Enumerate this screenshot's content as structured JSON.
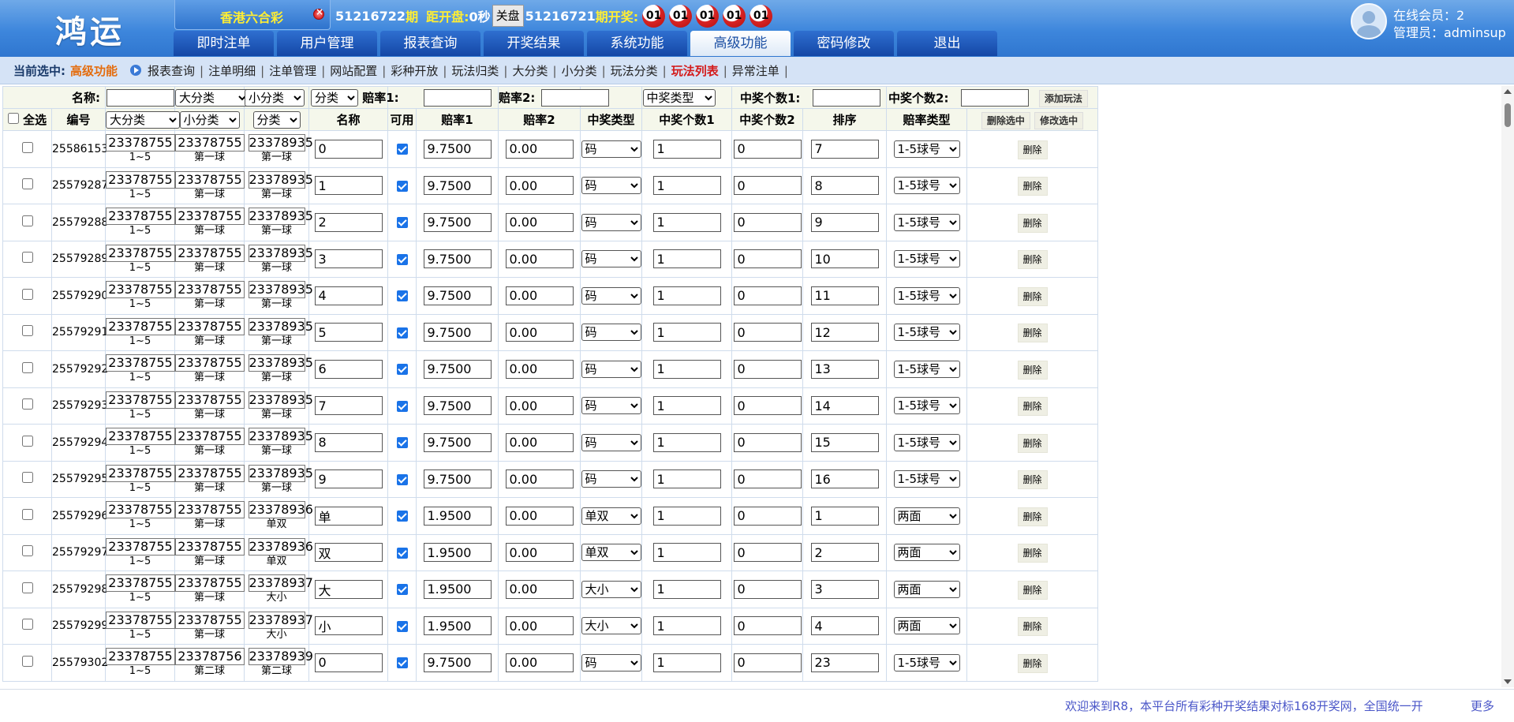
{
  "logo": "鸿运",
  "lottery": {
    "name": "香港六合彩"
  },
  "info": {
    "current_issue": "51216722",
    "issue_unit": "期",
    "countdown_label": "距开盘:",
    "countdown_value": "0秒",
    "stop_button": "关盘",
    "prev_issue": "51216721",
    "prev_label": "期开奖:",
    "balls": [
      "01",
      "01",
      "01",
      "01",
      "01"
    ]
  },
  "nav": [
    "即时注单",
    "用户管理",
    "报表查询",
    "开奖结果",
    "系统功能",
    "高级功能",
    "密码修改",
    "退出"
  ],
  "nav_active": "高级功能",
  "user": {
    "online": "在线会员：2",
    "admin": "管理员：adminsup"
  },
  "crumb": {
    "label": "当前选中:",
    "current": "高级功能",
    "links": [
      "报表查询",
      "注单明细",
      "注单管理",
      "网站配置",
      "彩种开放",
      "玩法归类",
      "大分类",
      "小分类",
      "玩法分类",
      "玩法列表",
      "异常注单"
    ],
    "active_link": "玩法列表"
  },
  "filter": {
    "name_label": "名称:",
    "big_cat": "大分类",
    "small_cat": "小分类",
    "cat": "分类",
    "odds1_label": "赔率1:",
    "odds2_label": "赔率2:",
    "win_type": "中奖类型",
    "win_count1_label": "中奖个数1:",
    "win_count2_label": "中奖个数2:",
    "add_button": "添加玩法"
  },
  "headers": {
    "select_all": "全选",
    "id": "编号",
    "big_cat": "大分类",
    "small_cat": "小分类",
    "cat": "分类",
    "name": "名称",
    "enabled": "可用",
    "odds1": "赔率1",
    "odds2": "赔率2",
    "win_type": "中奖类型",
    "win_count1": "中奖个数1",
    "win_count2": "中奖个数2",
    "order": "排序",
    "odds_type": "赔率类型",
    "delete_selected": "删除选中",
    "modify_selected": "修改选中"
  },
  "delete_label": "删除",
  "rows": [
    {
      "id": "25586153",
      "big": "23378755",
      "big_sub": "1~5",
      "small": "23378755",
      "small_sub": "第一球",
      "cat": "23378935",
      "cat_sub": "第一球",
      "name": "0",
      "odds1": "9.7500",
      "odds2": "0.00",
      "win_type": "码",
      "c1": "1",
      "c2": "0",
      "order": "7",
      "odds_type": "1-5球号"
    },
    {
      "id": "25579287",
      "big": "23378755",
      "big_sub": "1~5",
      "small": "23378755",
      "small_sub": "第一球",
      "cat": "23378935",
      "cat_sub": "第一球",
      "name": "1",
      "odds1": "9.7500",
      "odds2": "0.00",
      "win_type": "码",
      "c1": "1",
      "c2": "0",
      "order": "8",
      "odds_type": "1-5球号"
    },
    {
      "id": "25579288",
      "big": "23378755",
      "big_sub": "1~5",
      "small": "23378755",
      "small_sub": "第一球",
      "cat": "23378935",
      "cat_sub": "第一球",
      "name": "2",
      "odds1": "9.7500",
      "odds2": "0.00",
      "win_type": "码",
      "c1": "1",
      "c2": "0",
      "order": "9",
      "odds_type": "1-5球号"
    },
    {
      "id": "25579289",
      "big": "23378755",
      "big_sub": "1~5",
      "small": "23378755",
      "small_sub": "第一球",
      "cat": "23378935",
      "cat_sub": "第一球",
      "name": "3",
      "odds1": "9.7500",
      "odds2": "0.00",
      "win_type": "码",
      "c1": "1",
      "c2": "0",
      "order": "10",
      "odds_type": "1-5球号"
    },
    {
      "id": "25579290",
      "big": "23378755",
      "big_sub": "1~5",
      "small": "23378755",
      "small_sub": "第一球",
      "cat": "23378935",
      "cat_sub": "第一球",
      "name": "4",
      "odds1": "9.7500",
      "odds2": "0.00",
      "win_type": "码",
      "c1": "1",
      "c2": "0",
      "order": "11",
      "odds_type": "1-5球号"
    },
    {
      "id": "25579291",
      "big": "23378755",
      "big_sub": "1~5",
      "small": "23378755",
      "small_sub": "第一球",
      "cat": "23378935",
      "cat_sub": "第一球",
      "name": "5",
      "odds1": "9.7500",
      "odds2": "0.00",
      "win_type": "码",
      "c1": "1",
      "c2": "0",
      "order": "12",
      "odds_type": "1-5球号"
    },
    {
      "id": "25579292",
      "big": "23378755",
      "big_sub": "1~5",
      "small": "23378755",
      "small_sub": "第一球",
      "cat": "23378935",
      "cat_sub": "第一球",
      "name": "6",
      "odds1": "9.7500",
      "odds2": "0.00",
      "win_type": "码",
      "c1": "1",
      "c2": "0",
      "order": "13",
      "odds_type": "1-5球号"
    },
    {
      "id": "25579293",
      "big": "23378755",
      "big_sub": "1~5",
      "small": "23378755",
      "small_sub": "第一球",
      "cat": "23378935",
      "cat_sub": "第一球",
      "name": "7",
      "odds1": "9.7500",
      "odds2": "0.00",
      "win_type": "码",
      "c1": "1",
      "c2": "0",
      "order": "14",
      "odds_type": "1-5球号"
    },
    {
      "id": "25579294",
      "big": "23378755",
      "big_sub": "1~5",
      "small": "23378755",
      "small_sub": "第一球",
      "cat": "23378935",
      "cat_sub": "第一球",
      "name": "8",
      "odds1": "9.7500",
      "odds2": "0.00",
      "win_type": "码",
      "c1": "1",
      "c2": "0",
      "order": "15",
      "odds_type": "1-5球号"
    },
    {
      "id": "25579295",
      "big": "23378755",
      "big_sub": "1~5",
      "small": "23378755",
      "small_sub": "第一球",
      "cat": "23378935",
      "cat_sub": "第一球",
      "name": "9",
      "odds1": "9.7500",
      "odds2": "0.00",
      "win_type": "码",
      "c1": "1",
      "c2": "0",
      "order": "16",
      "odds_type": "1-5球号"
    },
    {
      "id": "25579296",
      "big": "23378755",
      "big_sub": "1~5",
      "small": "23378755",
      "small_sub": "第一球",
      "cat": "23378936",
      "cat_sub": "单双",
      "name": "单",
      "odds1": "1.9500",
      "odds2": "0.00",
      "win_type": "单双",
      "c1": "1",
      "c2": "0",
      "order": "1",
      "odds_type": "两面"
    },
    {
      "id": "25579297",
      "big": "23378755",
      "big_sub": "1~5",
      "small": "23378755",
      "small_sub": "第一球",
      "cat": "23378936",
      "cat_sub": "单双",
      "name": "双",
      "odds1": "1.9500",
      "odds2": "0.00",
      "win_type": "单双",
      "c1": "1",
      "c2": "0",
      "order": "2",
      "odds_type": "两面"
    },
    {
      "id": "25579298",
      "big": "23378755",
      "big_sub": "1~5",
      "small": "23378755",
      "small_sub": "第一球",
      "cat": "23378937",
      "cat_sub": "大小",
      "name": "大",
      "odds1": "1.9500",
      "odds2": "0.00",
      "win_type": "大小",
      "c1": "1",
      "c2": "0",
      "order": "3",
      "odds_type": "两面"
    },
    {
      "id": "25579299",
      "big": "23378755",
      "big_sub": "1~5",
      "small": "23378755",
      "small_sub": "第一球",
      "cat": "23378937",
      "cat_sub": "大小",
      "name": "小",
      "odds1": "1.9500",
      "odds2": "0.00",
      "win_type": "大小",
      "c1": "1",
      "c2": "0",
      "order": "4",
      "odds_type": "两面"
    },
    {
      "id": "25579302",
      "big": "23378755",
      "big_sub": "1~5",
      "small": "23378756",
      "small_sub": "第二球",
      "cat": "23378939",
      "cat_sub": "第二球",
      "name": "0",
      "odds1": "9.7500",
      "odds2": "0.00",
      "win_type": "码",
      "c1": "1",
      "c2": "0",
      "order": "23",
      "odds_type": "1-5球号"
    }
  ],
  "footer": {
    "ticker": "欢迎来到R8，本平台所有彩种开奖结果对标168开奖网，全国统一开",
    "more": "更多"
  },
  "colors": {
    "header": "#3d86dc",
    "nav": "#1447a6",
    "crumb_bg": "#d5e3f6",
    "accent": "#e46d0f",
    "ticker": "#4a56c8"
  }
}
